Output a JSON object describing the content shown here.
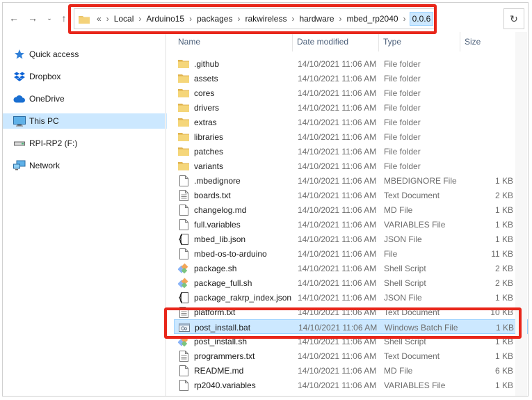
{
  "address": {
    "overflow": "«",
    "crumbs": [
      "Local",
      "Arduino15",
      "packages",
      "rakwireless",
      "hardware",
      "mbed_rp2040"
    ],
    "current": "0.0.6"
  },
  "nav": {
    "items": [
      {
        "label": "Quick access",
        "icon": "star-icon"
      },
      {
        "label": "Dropbox",
        "icon": "dropbox-icon"
      },
      {
        "label": "OneDrive",
        "icon": "cloud-icon"
      },
      {
        "label": "This PC",
        "icon": "computer-icon",
        "selected": true
      },
      {
        "label": "RPI-RP2 (F:)",
        "icon": "drive-icon"
      },
      {
        "label": "Network",
        "icon": "network-icon"
      }
    ]
  },
  "columns": {
    "name": "Name",
    "date": "Date modified",
    "type": "Type",
    "size": "Size"
  },
  "files": [
    {
      "name": ".github",
      "date": "14/10/2021 11:06 AM",
      "type": "File folder",
      "size": "",
      "icon": "folder-icon"
    },
    {
      "name": "assets",
      "date": "14/10/2021 11:06 AM",
      "type": "File folder",
      "size": "",
      "icon": "folder-icon"
    },
    {
      "name": "cores",
      "date": "14/10/2021 11:06 AM",
      "type": "File folder",
      "size": "",
      "icon": "folder-icon"
    },
    {
      "name": "drivers",
      "date": "14/10/2021 11:06 AM",
      "type": "File folder",
      "size": "",
      "icon": "folder-icon"
    },
    {
      "name": "extras",
      "date": "14/10/2021 11:06 AM",
      "type": "File folder",
      "size": "",
      "icon": "folder-icon"
    },
    {
      "name": "libraries",
      "date": "14/10/2021 11:06 AM",
      "type": "File folder",
      "size": "",
      "icon": "folder-icon"
    },
    {
      "name": "patches",
      "date": "14/10/2021 11:06 AM",
      "type": "File folder",
      "size": "",
      "icon": "folder-icon"
    },
    {
      "name": "variants",
      "date": "14/10/2021 11:06 AM",
      "type": "File folder",
      "size": "",
      "icon": "folder-icon"
    },
    {
      "name": ".mbedignore",
      "date": "14/10/2021 11:06 AM",
      "type": "MBEDIGNORE File",
      "size": "1 KB",
      "icon": "file-icon"
    },
    {
      "name": "boards.txt",
      "date": "14/10/2021 11:06 AM",
      "type": "Text Document",
      "size": "2 KB",
      "icon": "text-file-icon"
    },
    {
      "name": "changelog.md",
      "date": "14/10/2021 11:06 AM",
      "type": "MD File",
      "size": "1 KB",
      "icon": "file-icon"
    },
    {
      "name": "full.variables",
      "date": "14/10/2021 11:06 AM",
      "type": "VARIABLES File",
      "size": "1 KB",
      "icon": "file-icon"
    },
    {
      "name": "mbed_lib.json",
      "date": "14/10/2021 11:06 AM",
      "type": "JSON File",
      "size": "1 KB",
      "icon": "json-file-icon"
    },
    {
      "name": "mbed-os-to-arduino",
      "date": "14/10/2021 11:06 AM",
      "type": "File",
      "size": "11 KB",
      "icon": "file-icon"
    },
    {
      "name": "package.sh",
      "date": "14/10/2021 11:06 AM",
      "type": "Shell Script",
      "size": "2 KB",
      "icon": "shell-script-icon"
    },
    {
      "name": "package_full.sh",
      "date": "14/10/2021 11:06 AM",
      "type": "Shell Script",
      "size": "2 KB",
      "icon": "shell-script-icon"
    },
    {
      "name": "package_rakrp_index.json",
      "date": "14/10/2021 11:06 AM",
      "type": "JSON File",
      "size": "1 KB",
      "icon": "json-file-icon"
    },
    {
      "name": "platform.txt",
      "date": "14/10/2021 11:06 AM",
      "type": "Text Document",
      "size": "10 KB",
      "icon": "text-file-icon"
    },
    {
      "name": "post_install.bat",
      "date": "14/10/2021 11:06 AM",
      "type": "Windows Batch File",
      "size": "1 KB",
      "icon": "batch-file-icon",
      "selected": true
    },
    {
      "name": "post_install.sh",
      "date": "14/10/2021 11:06 AM",
      "type": "Shell Script",
      "size": "1 KB",
      "icon": "shell-script-icon"
    },
    {
      "name": "programmers.txt",
      "date": "14/10/2021 11:06 AM",
      "type": "Text Document",
      "size": "1 KB",
      "icon": "text-file-icon"
    },
    {
      "name": "README.md",
      "date": "14/10/2021 11:06 AM",
      "type": "MD File",
      "size": "6 KB",
      "icon": "file-icon"
    },
    {
      "name": "rp2040.variables",
      "date": "14/10/2021 11:06 AM",
      "type": "VARIABLES File",
      "size": "1 KB",
      "icon": "file-icon"
    }
  ],
  "colors": {
    "highlight": "#e8261a",
    "selection": "#cce8ff",
    "folder": "#e9c46a"
  }
}
